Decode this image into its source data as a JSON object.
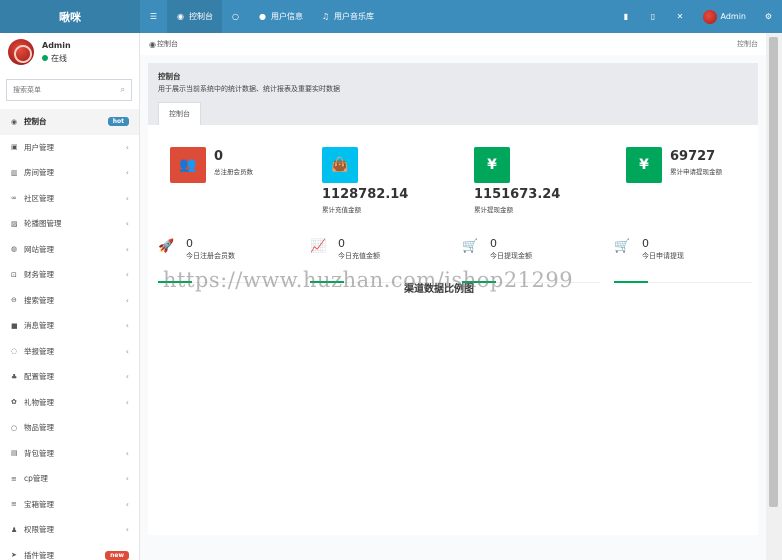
{
  "app": {
    "logo": "啾咪"
  },
  "topnav": {
    "items": [
      {
        "icon": "dashboard-icon",
        "glyph": "☰",
        "label": ""
      },
      {
        "icon": "dashboard-icon",
        "glyph": "◉",
        "label": "控制台"
      },
      {
        "icon": "circle-icon",
        "glyph": "○",
        "label": ""
      },
      {
        "icon": "user-icon",
        "glyph": "●",
        "label": "用户信息"
      },
      {
        "icon": "music-icon",
        "glyph": "♫",
        "label": "用户音乐库"
      }
    ],
    "right": {
      "username": "Admin"
    }
  },
  "sidebar": {
    "user": {
      "name": "Admin",
      "status": "在线"
    },
    "search_placeholder": "搜索菜单",
    "items": [
      {
        "label": "控制台",
        "glyph": "◉",
        "badge": "hot"
      },
      {
        "label": "用户管理",
        "glyph": "▣"
      },
      {
        "label": "房间管理",
        "glyph": "▥"
      },
      {
        "label": "社区管理",
        "glyph": "∞"
      },
      {
        "label": "轮播图管理",
        "glyph": "▨"
      },
      {
        "label": "网站管理",
        "glyph": "◍"
      },
      {
        "label": "财务管理",
        "glyph": "⊡"
      },
      {
        "label": "搜索管理",
        "glyph": "⊖"
      },
      {
        "label": "消息管理",
        "glyph": "■"
      },
      {
        "label": "举报管理",
        "glyph": "◌"
      },
      {
        "label": "配置管理",
        "glyph": "♣"
      },
      {
        "label": "礼物管理",
        "glyph": "✿"
      },
      {
        "label": "物品管理",
        "glyph": "○"
      },
      {
        "label": "背包管理",
        "glyph": "▤"
      },
      {
        "label": "cp管理",
        "glyph": "≡"
      },
      {
        "label": "宝箱管理",
        "glyph": "≡"
      },
      {
        "label": "权限管理",
        "glyph": "♟"
      },
      {
        "label": "插件管理",
        "glyph": "➤",
        "badge": "new"
      }
    ]
  },
  "content": {
    "breadcrumb": "控制台",
    "breadcrumb_right": "控制台",
    "panel_title": "控制台",
    "panel_desc": "用于展示当前系统中的统计数据、统计报表及重要实时数据",
    "tab": "控制台",
    "stats": [
      {
        "value": "0",
        "label": "总注册会员数",
        "color": "#dd4b39",
        "icon": "users-icon"
      },
      {
        "value": "1128782.14",
        "label": "累计充值金额",
        "color": "#00c0ef",
        "icon": "bag-icon"
      },
      {
        "value": "1151673.24",
        "label": "累计提现金额",
        "color": "#00a65a",
        "icon": "yen-icon"
      },
      {
        "value": "69727",
        "label": "累计申请提现金额",
        "color": "#00a65a",
        "icon": "yen-icon"
      }
    ],
    "mini_stats": [
      {
        "value": "0",
        "label": "今日注册会员数",
        "icon": "rocket-icon"
      },
      {
        "value": "0",
        "label": "今日充值金额",
        "icon": "line-chart-icon"
      },
      {
        "value": "0",
        "label": "今日提现金额",
        "icon": "cart-icon"
      },
      {
        "value": "0",
        "label": "今日申请提现",
        "icon": "cart-icon"
      }
    ],
    "chart_title": "渠道数据比例图",
    "watermark": "https://www.huzhan.com/ishop21299"
  }
}
